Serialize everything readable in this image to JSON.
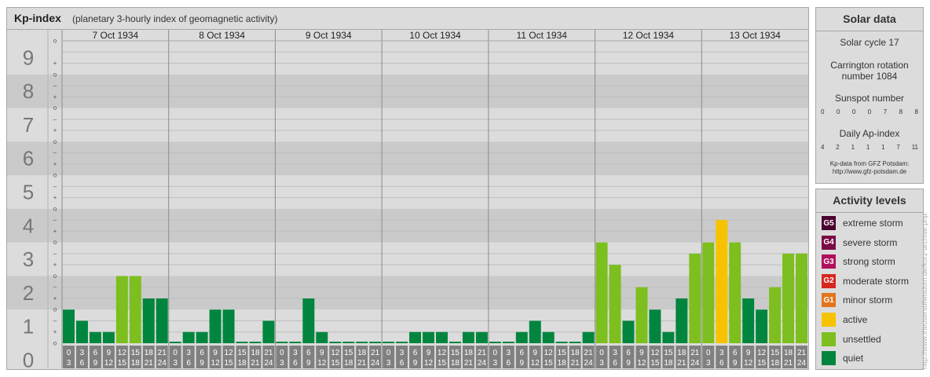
{
  "title": "Kp-index",
  "subtitle": "(planetary 3-hourly index of geomagnetic activity)",
  "chart_data": {
    "type": "bar",
    "ylim": [
      0,
      9
    ],
    "y_ticks": [
      "0",
      "1",
      "2",
      "3",
      "4",
      "5",
      "6",
      "7",
      "8",
      "9"
    ],
    "sub_ticks": [
      "o",
      "+",
      "–"
    ],
    "days": [
      "7 Oct 1934",
      "8 Oct 1934",
      "9 Oct 1934",
      "10 Oct 1934",
      "11 Oct 1934",
      "12 Oct 1934",
      "13 Oct 1934"
    ],
    "interval_start": [
      "0",
      "3",
      "6",
      "9",
      "12",
      "15",
      "18",
      "21"
    ],
    "interval_end": [
      "3",
      "6",
      "9",
      "12",
      "15",
      "18",
      "21",
      "24"
    ],
    "values": [
      1.0,
      0.667,
      0.333,
      0.333,
      2.0,
      2.0,
      1.333,
      1.333,
      0.0,
      0.333,
      0.333,
      1.0,
      1.0,
      0.0,
      0.0,
      0.667,
      0.0,
      0.0,
      1.333,
      0.333,
      0.0,
      0.0,
      0.0,
      0.0,
      0.0,
      0.0,
      0.333,
      0.333,
      0.333,
      0.0,
      0.333,
      0.333,
      0.0,
      0.0,
      0.333,
      0.667,
      0.333,
      0.0,
      0.0,
      0.333,
      3.0,
      2.333,
      0.667,
      1.667,
      1.0,
      0.333,
      1.333,
      2.667,
      3.0,
      3.667,
      3.0,
      1.333,
      1.0,
      1.667,
      2.667,
      2.667
    ]
  },
  "solar": {
    "heading": "Solar data",
    "cycle": "Solar cycle 17",
    "carrington_line1": "Carrington rotation",
    "carrington_line2": "number 1084",
    "sunspot_label": "Sunspot number",
    "sunspot_values": [
      "0",
      "0",
      "0",
      "0",
      "7",
      "8",
      "8"
    ],
    "ap_label": "Daily Ap-index",
    "ap_values": [
      "4",
      "2",
      "1",
      "1",
      "1",
      "7",
      "11"
    ],
    "credit_line1": "Kp-data from GFZ Potsdam:",
    "credit_line2": "http://www.gfz-potsdam.de"
  },
  "activity": {
    "heading": "Activity levels",
    "levels": [
      {
        "badge": "G5",
        "label": "extreme storm",
        "color": "#4a0030"
      },
      {
        "badge": "G4",
        "label": "severe storm",
        "color": "#7a0a45"
      },
      {
        "badge": "G3",
        "label": "strong storm",
        "color": "#b0105a"
      },
      {
        "badge": "G2",
        "label": "moderate storm",
        "color": "#d7261e"
      },
      {
        "badge": "G1",
        "label": "minor storm",
        "color": "#e4741c"
      },
      {
        "badge": "",
        "label": "active",
        "color": "#f7c300"
      },
      {
        "badge": "",
        "label": "unsettled",
        "color": "#7cbf1e"
      },
      {
        "badge": "",
        "label": "quiet",
        "color": "#00853e"
      }
    ]
  },
  "watermark": "http://www.theusersofwisdom.de/kurz-archive.php"
}
